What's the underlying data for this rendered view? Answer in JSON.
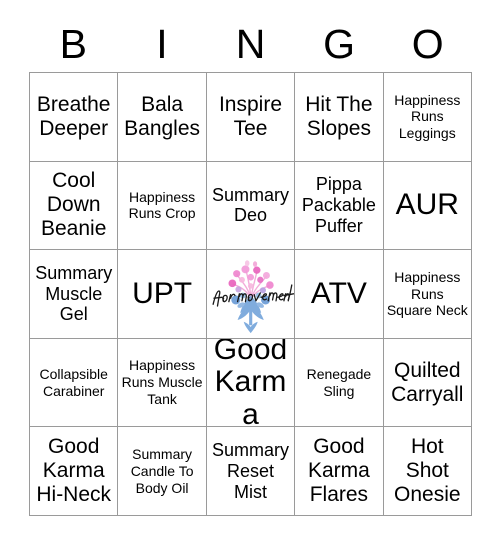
{
  "card": {
    "header_letters": [
      "B",
      "I",
      "N",
      "G",
      "O"
    ],
    "rows": [
      [
        {
          "text": "Breathe Deeper",
          "size": "lg"
        },
        {
          "text": "Bala Bangles",
          "size": "lg"
        },
        {
          "text": "Inspire Tee",
          "size": "lg"
        },
        {
          "text": "Hit The Slopes",
          "size": "lg"
        },
        {
          "text": "Happiness Runs Leggings",
          "size": "sm"
        }
      ],
      [
        {
          "text": "Cool Down Beanie",
          "size": "lg"
        },
        {
          "text": "Happiness Runs Crop",
          "size": "sm"
        },
        {
          "text": "Summary Deo",
          "size": "md"
        },
        {
          "text": "Pippa Packable Puffer",
          "size": "md"
        },
        {
          "text": "AUR",
          "size": "xl"
        }
      ],
      [
        {
          "text": "Summary Muscle Gel",
          "size": "md"
        },
        {
          "text": "UPT",
          "size": "xl"
        },
        {
          "text": "",
          "size": "md",
          "free_space": true
        },
        {
          "text": "ATV",
          "size": "xl"
        },
        {
          "text": "Happiness Runs Square Neck",
          "size": "sm"
        }
      ],
      [
        {
          "text": "Collapsible Carabiner",
          "size": "sm"
        },
        {
          "text": "Happiness Runs Muscle Tank",
          "size": "sm"
        },
        {
          "text": "Good Karma",
          "size": "xl"
        },
        {
          "text": "Renegade Sling",
          "size": "sm"
        },
        {
          "text": "Quilted Carryall",
          "size": "lg"
        }
      ],
      [
        {
          "text": "Good Karma Hi-Neck",
          "size": "lg"
        },
        {
          "text": "Summary Candle To Body Oil",
          "size": "sm"
        },
        {
          "text": "Summary Reset Mist",
          "size": "md"
        },
        {
          "text": "Good Karma Flares",
          "size": "lg"
        },
        {
          "text": "Hot Shot Onesie",
          "size": "lg"
        }
      ]
    ],
    "free_space": {
      "logo_name": "for-movement-floral-logo",
      "script_text": "for movement",
      "colors": {
        "pink": "#ef86cf",
        "magenta": "#e964bd",
        "light_pink": "#f7b8de",
        "lavender": "#c9a6e0",
        "blue": "#6f9fd8",
        "light_blue": "#9dc1e6",
        "script": "#1a1a1a"
      }
    },
    "grid": {
      "border_color": "#9a9a9a",
      "background": "#ffffff",
      "text_color": "#000000"
    }
  }
}
